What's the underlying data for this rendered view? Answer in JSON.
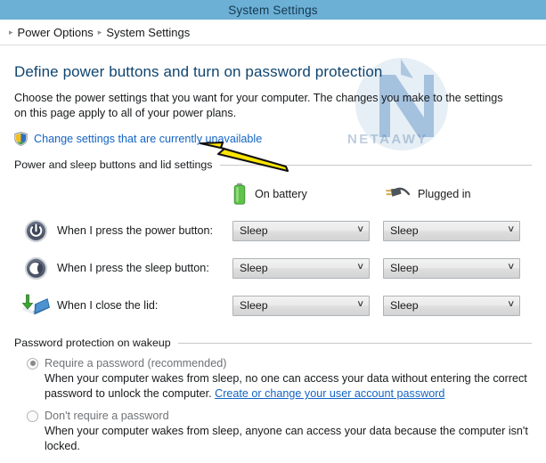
{
  "window": {
    "title": "System Settings"
  },
  "breadcrumb": {
    "items": [
      "Power Options",
      "System Settings"
    ],
    "separator": "▸"
  },
  "page": {
    "heading": "Define power buttons and turn on password protection",
    "description": "Choose the power settings that you want for your computer. The changes you make to the settings on this page apply to all of your power plans.",
    "uac_link": "Change settings that are currently unavailable"
  },
  "power_section": {
    "group_label": "Power and sleep buttons and lid settings",
    "columns": [
      {
        "label": "On battery",
        "icon": "battery-icon"
      },
      {
        "label": "Plugged in",
        "icon": "power-plug-icon"
      }
    ],
    "rows": [
      {
        "icon": "power-button-icon",
        "label": "When I press the power button:",
        "on_battery": "Sleep",
        "plugged_in": "Sleep"
      },
      {
        "icon": "sleep-button-icon",
        "label": "When I press the sleep button:",
        "on_battery": "Sleep",
        "plugged_in": "Sleep"
      },
      {
        "icon": "laptop-lid-icon",
        "label": "When I close the lid:",
        "on_battery": "Sleep",
        "plugged_in": "Sleep"
      }
    ],
    "chevron": "∨"
  },
  "password_section": {
    "group_label": "Password protection on wakeup",
    "options": [
      {
        "label": "Require a password (recommended)",
        "selected": true,
        "description_before_link": "When your computer wakes from sleep, no one can access your data without entering the correct password to unlock the computer. ",
        "link": "Create or change your user account password",
        "description_after_link": ""
      },
      {
        "label": "Don't require a password",
        "selected": false,
        "description_before_link": "When your computer wakes from sleep, anyone can access your data because the computer isn't locked.",
        "link": "",
        "description_after_link": ""
      }
    ]
  },
  "watermark": {
    "text": "NETAAWY"
  },
  "colors": {
    "titlebar": "#6cb0d6",
    "heading": "#10456f",
    "link": "#1364c4",
    "battery_green": "#5fc24a",
    "annotation_yellow": "#ffe600"
  }
}
